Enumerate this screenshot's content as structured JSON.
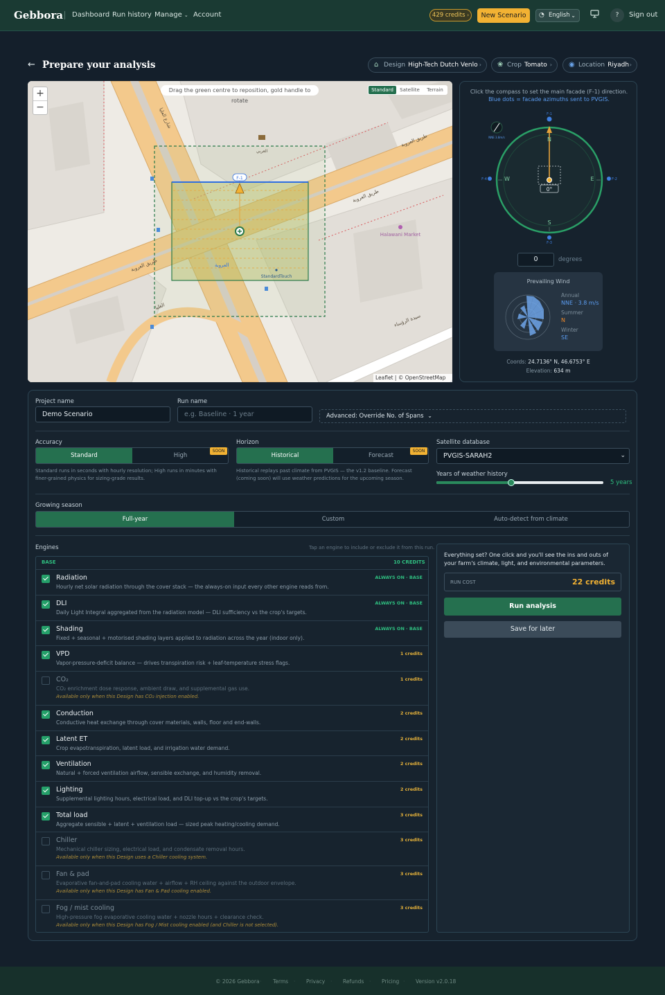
{
  "header": {
    "logo": "Gebbora",
    "nav": [
      "Dashboard",
      "Run history",
      "Manage",
      "Account"
    ],
    "credits": "429 credits",
    "new_scenario": "New Scenario",
    "language": "English",
    "help": "?",
    "sign_out": "Sign out"
  },
  "page": {
    "title": "Prepare your analysis",
    "chips": [
      {
        "key": "Design",
        "value": "High-Tech Dutch Venlo"
      },
      {
        "key": "Crop",
        "value": "Tomato"
      },
      {
        "key": "Location",
        "value": "Riyadh"
      }
    ]
  },
  "map": {
    "zoom_in": "+",
    "zoom_out": "−",
    "hint": "Drag the green centre to reposition, gold handle to rotate",
    "layers": [
      "Standard",
      "Satellite",
      "Terrain"
    ],
    "active_layer": "Standard",
    "facade_label": "F-1",
    "place_labels": [
      "Halawani Market",
      "StandardTouch",
      "شارع العليا",
      "طريق العروبة",
      "طريق العروبة",
      "طريق العروبة",
      "العليا",
      "العروبة",
      "سيدة الرؤساء",
      "العربي"
    ],
    "attribution": "Leaflet | © OpenStreetMap"
  },
  "compass": {
    "instruction": "Click the compass to set the main facade (F-1) direction.",
    "legend": "Blue dots = facade azimuths sent to PVGIS.",
    "cardinals": [
      "N",
      "E",
      "S",
      "W"
    ],
    "facades": [
      "F-1",
      "F-2",
      "F-3",
      "F-4"
    ],
    "center_readout": "0°",
    "degrees_value": "0",
    "degrees_label": "degrees",
    "wind_badge": "NNE 3.8m/s"
  },
  "wind": {
    "title": "Prevailing Wind",
    "annual_label": "Annual",
    "annual_value": "NNE · 3.8 m/s",
    "summer_label": "Summer",
    "summer_value": "N",
    "winter_label": "Winter",
    "winter_value": "SE"
  },
  "location_info": {
    "coords_label": "Coords:",
    "coords_value": "24.7136° N, 46.6753° E",
    "elevation_label": "Elevation:",
    "elevation_value": "634 m"
  },
  "form": {
    "project_label": "Project name",
    "project_value": "Demo Scenario",
    "run_label": "Run name",
    "run_placeholder": "e.g. Baseline · 1 year",
    "advanced": "Advanced: Override No. of Spans",
    "accuracy_label": "Accuracy",
    "accuracy_options": [
      "Standard",
      "High"
    ],
    "accuracy_help": "Standard runs in seconds with hourly resolution; High runs in minutes with finer-grained physics for sizing-grade results.",
    "horizon_label": "Horizon",
    "horizon_options": [
      "Historical",
      "Forecast"
    ],
    "horizon_help": "Historical replays past climate from PVGIS — the v1.2 baseline. Forecast (coming soon) will use weather predictions for the upcoming season.",
    "soon": "SOON",
    "satdb_label": "Satellite database",
    "satdb_value": "PVGIS-SARAH2",
    "years_label": "Years of weather history",
    "years_value": "5 years",
    "years_fraction": 0.45,
    "season_label": "Growing season",
    "season_options": [
      "Full-year",
      "Custom",
      "Auto-detect from climate"
    ]
  },
  "engines": {
    "label": "Engines",
    "hint": "Tap an engine to include or exclude it from this run.",
    "base_label": "BASE",
    "base_credits": "10 CREDITS",
    "items": [
      {
        "name": "Radiation",
        "desc": "Hourly net solar radiation through the cover stack — the always-on input every other engine reads from.",
        "tag": "ALWAYS ON · BASE",
        "on": true
      },
      {
        "name": "DLI",
        "desc": "Daily Light Integral aggregated from the radiation model — DLI sufficiency vs the crop's targets.",
        "tag": "ALWAYS ON · BASE",
        "on": true
      },
      {
        "name": "Shading",
        "desc": "Fixed + seasonal + motorised shading layers applied to radiation across the year (indoor only).",
        "tag": "ALWAYS ON · BASE",
        "on": true
      },
      {
        "name": "VPD",
        "desc": "Vapor-pressure-deficit balance — drives transpiration risk + leaf-temperature stress flags.",
        "cost": "1 credits",
        "on": true
      },
      {
        "name": "CO₂",
        "desc": "CO₂ enrichment dose response, ambient draw, and supplemental gas use.",
        "note": "Available only when this Design has CO₂ injection enabled.",
        "cost": "1 credits",
        "on": false
      },
      {
        "name": "Conduction",
        "desc": "Conductive heat exchange through cover materials, walls, floor and end-walls.",
        "cost": "2 credits",
        "on": true
      },
      {
        "name": "Latent ET",
        "desc": "Crop evapotranspiration, latent load, and irrigation water demand.",
        "cost": "2 credits",
        "on": true
      },
      {
        "name": "Ventilation",
        "desc": "Natural + forced ventilation airflow, sensible exchange, and humidity removal.",
        "cost": "2 credits",
        "on": true
      },
      {
        "name": "Lighting",
        "desc": "Supplemental lighting hours, electrical load, and DLI top-up vs the crop's targets.",
        "cost": "2 credits",
        "on": true
      },
      {
        "name": "Total load",
        "desc": "Aggregate sensible + latent + ventilation load — sized peak heating/cooling demand.",
        "cost": "3 credits",
        "on": true
      },
      {
        "name": "Chiller",
        "desc": "Mechanical chiller sizing, electrical load, and condensate removal hours.",
        "note": "Available only when this Design uses a Chiller cooling system.",
        "cost": "3 credits",
        "on": false
      },
      {
        "name": "Fan & pad",
        "desc": "Evaporative fan-and-pad cooling water + airflow + RH ceiling against the outdoor envelope.",
        "note": "Available only when this Design has Fan & Pad cooling enabled.",
        "cost": "3 credits",
        "on": false
      },
      {
        "name": "Fog / mist cooling",
        "desc": "High-pressure fog evaporative cooling water + nozzle hours + clearance check.",
        "note": "Available only when this Design has Fog / Mist cooling enabled (and Chiller is not selected).",
        "cost": "3 credits",
        "on": false
      }
    ]
  },
  "run": {
    "intro": "Everything set? One click and you'll see the ins and outs of your farm's climate, light, and environmental parameters.",
    "cost_label": "RUN COST",
    "cost_value": "22 credits",
    "run_button": "Run analysis",
    "save_button": "Save for later"
  },
  "footer": {
    "copyright": "© 2026 Gebbora",
    "links": [
      "Terms",
      "Privacy",
      "Refunds",
      "Pricing"
    ],
    "version": "Version v2.0.18"
  },
  "colors": {
    "accent": "#25704f",
    "gold": "#f2b233",
    "facade_blue": "#3f7fe0"
  }
}
